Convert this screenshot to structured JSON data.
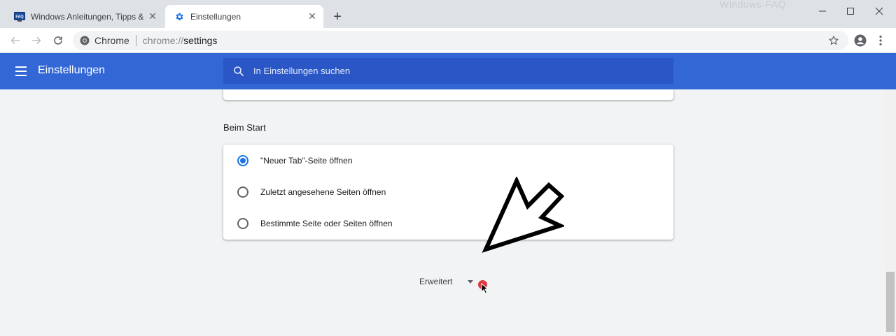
{
  "tabs": [
    {
      "title": "Windows Anleitungen, Tipps & T",
      "icon": "faq-favicon",
      "close_label": "✕",
      "active": false
    },
    {
      "title": "Einstellungen",
      "icon": "gear-icon",
      "close_label": "✕",
      "active": true
    }
  ],
  "newtab_label": "+",
  "watermark": "Windows-FAQ",
  "toolbar": {
    "site_name": "Chrome",
    "url_scheme": "chrome://",
    "url_path": "settings"
  },
  "header": {
    "title": "Einstellungen",
    "search_placeholder": "In Einstellungen suchen"
  },
  "startup": {
    "section_title": "Beim Start",
    "options": [
      {
        "label": "\"Neuer Tab\"-Seite öffnen",
        "checked": true
      },
      {
        "label": "Zuletzt angesehene Seiten öffnen",
        "checked": false
      },
      {
        "label": "Bestimmte Seite oder Seiten öffnen",
        "checked": false
      }
    ]
  },
  "advanced_label": "Erweitert",
  "colors": {
    "header_blue": "#3367d6",
    "search_blue": "#2a56c6",
    "radio_blue": "#1a73e8",
    "click_dot": "#e0393e"
  }
}
